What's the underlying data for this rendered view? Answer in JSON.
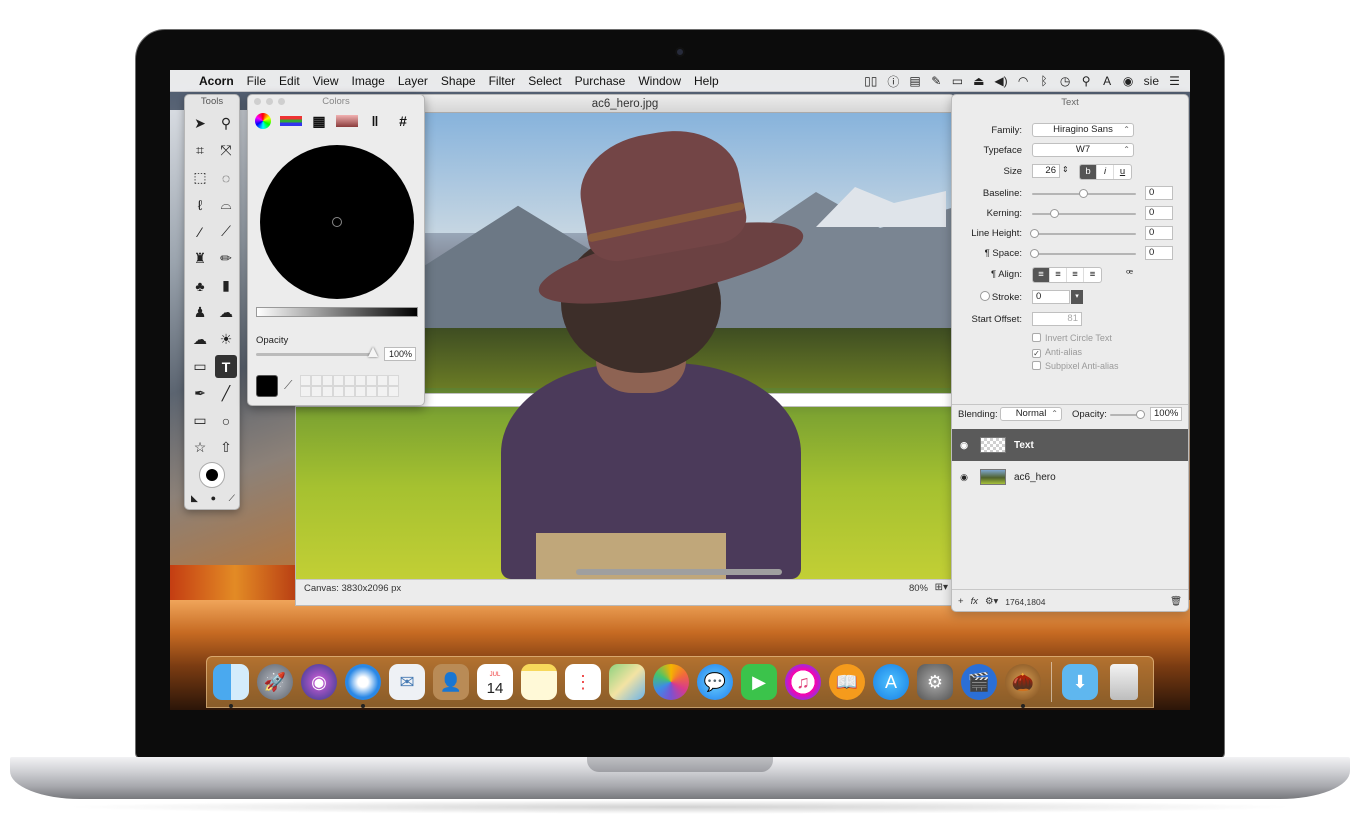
{
  "menubar": {
    "apple_icon": "apple-icon",
    "app_name": "Acorn",
    "items": [
      "File",
      "Edit",
      "View",
      "Image",
      "Layer",
      "Shape",
      "Filter",
      "Select",
      "Purchase",
      "Window",
      "Help"
    ],
    "user": "sie",
    "status_icons": [
      "display-icon",
      "info-icon",
      "clipboard-icon",
      "pencil-icon",
      "battery-icon",
      "airplay-icon",
      "volume-icon",
      "wifi-icon",
      "bluetooth-icon",
      "time-machine-icon",
      "spotlight-icon",
      "input-icon",
      "siri-icon",
      "list-icon"
    ]
  },
  "document": {
    "title": "ac6_hero.jpg",
    "canvas_info": "Canvas: 3830x2096 px",
    "zoom": "80%"
  },
  "tools": {
    "title": "Tools",
    "items": [
      "arrow-icon",
      "zoom-icon",
      "crop-icon",
      "transform-icon",
      "rect-select-icon",
      "ellipse-select-icon",
      "lasso-icon",
      "polygon-lasso-icon",
      "magic-wand-icon",
      "magic-select-icon",
      "brush-icon",
      "pencil-icon",
      "clone-icon",
      "smudge-icon",
      "stamp-icon",
      "blur-icon",
      "cloud-icon",
      "sun-icon",
      "gradient-icon",
      "text-icon",
      "bezier-icon",
      "line-icon",
      "rect-shape-icon",
      "oval-shape-icon",
      "star-icon",
      "arrow-shape-icon"
    ],
    "selected": "text-icon"
  },
  "colors": {
    "title": "Colors",
    "tabs": [
      "color-wheel-icon",
      "sliders-icon",
      "palettes-icon",
      "image-palette-icon",
      "pencils-icon",
      "#"
    ],
    "opacity_label": "Opacity",
    "opacity_value": "100%",
    "opacity": 1.0,
    "current_color": "#000000"
  },
  "inspector": {
    "title": "Text",
    "family_label": "Family:",
    "family": "Hiragino Sans",
    "typeface_label": "Typeface",
    "typeface": "W7",
    "size_label": "Size",
    "size": "26",
    "style_buttons": [
      "b",
      "i",
      "u"
    ],
    "baseline_label": "Baseline:",
    "baseline": "0",
    "kerning_label": "Kerning:",
    "kerning": "0",
    "line_height_label": "Line Height:",
    "line_height": "0",
    "space_label": "¶ Space:",
    "space": "0",
    "align_label": "¶ Align:",
    "stroke_label": "Stroke:",
    "stroke": "0",
    "start_offset_label": "Start Offset:",
    "start_offset": "81",
    "checks": [
      "Invert Circle Text",
      "Anti-alias",
      "Subpixel Anti-alias"
    ],
    "blending_label": "Blending:",
    "blending": "Normal",
    "opacity_label": "Opacity:",
    "opacity": "100%",
    "layers": [
      {
        "name": "Text",
        "selected": true
      },
      {
        "name": "ac6_hero",
        "selected": false
      }
    ],
    "footer_coords": "1764,1804"
  },
  "dock": {
    "calendar_month": "JUL",
    "calendar_day": "14",
    "apps": [
      "finder-icon",
      "launchpad-icon",
      "siri-icon",
      "safari-icon",
      "mail-icon",
      "contacts-icon",
      "calendar-icon",
      "notes-icon",
      "reminders-icon",
      "maps-icon",
      "photos-icon",
      "messages-icon",
      "facetime-icon",
      "itunes-icon",
      "ibooks-icon",
      "app-store-icon",
      "system-preferences-icon",
      "iphoto-icon",
      "acorn-icon",
      "downloads-icon",
      "trash-icon"
    ]
  }
}
